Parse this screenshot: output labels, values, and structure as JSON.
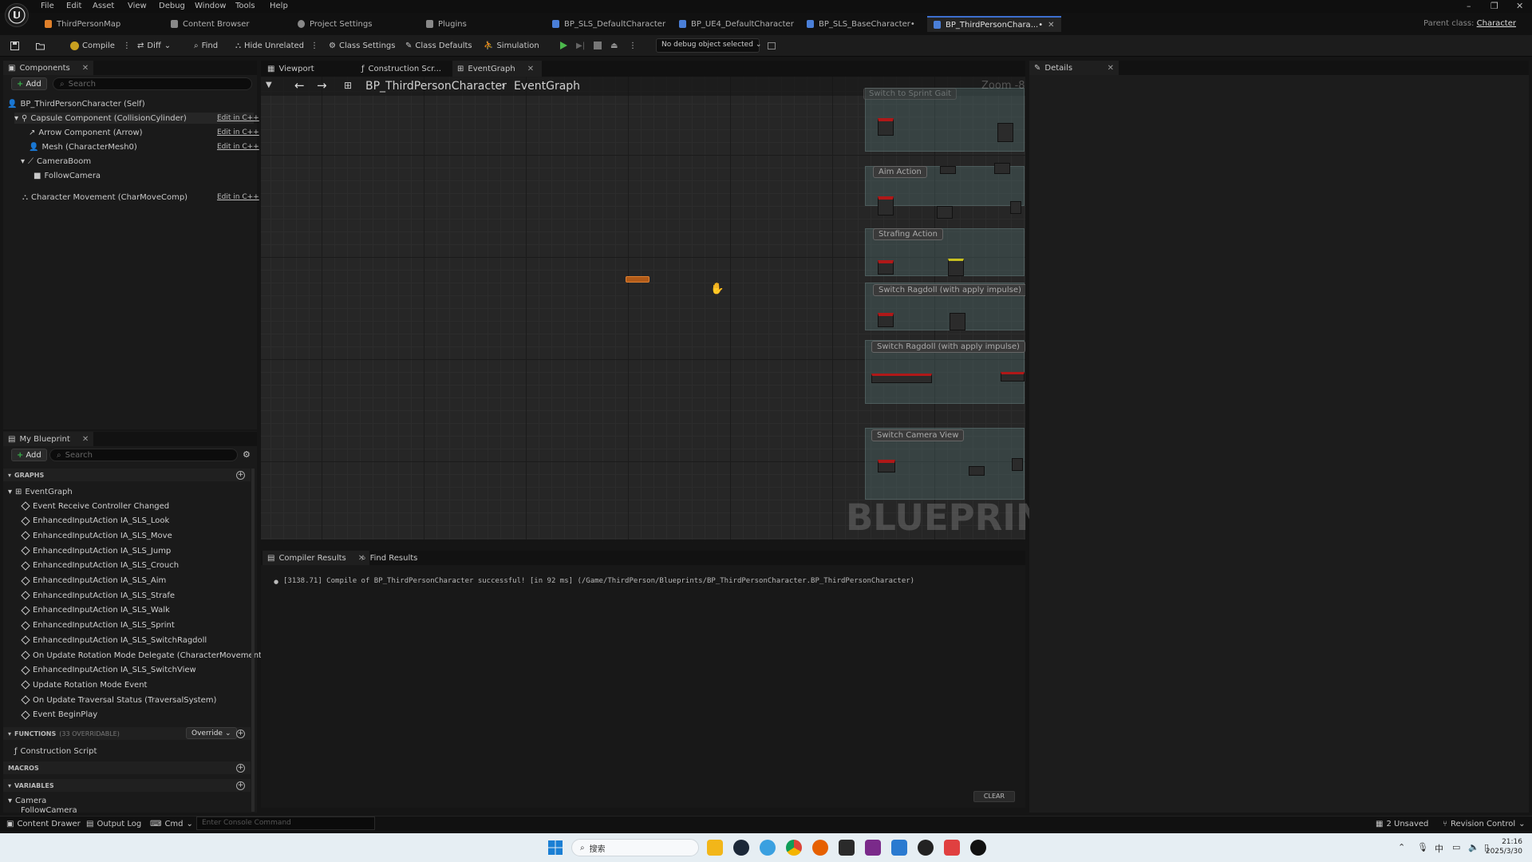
{
  "menu": [
    "File",
    "Edit",
    "Asset",
    "View",
    "Debug",
    "Window",
    "Tools",
    "Help"
  ],
  "doc_tabs": [
    {
      "label": "ThirdPersonMap",
      "color": "#e0802a"
    },
    {
      "label": "Content Browser",
      "color": "#999999"
    },
    {
      "label": "Project Settings",
      "color": "#999999"
    },
    {
      "label": "Plugins",
      "color": "#999999"
    },
    {
      "label": "BP_SLS_DefaultCharacter",
      "color": "#4a7fd8"
    },
    {
      "label": "BP_UE4_DefaultCharacter",
      "color": "#4a7fd8"
    },
    {
      "label": "BP_SLS_BaseCharacter•",
      "color": "#4a7fd8"
    },
    {
      "label": "BP_ThirdPersonChara...•",
      "color": "#4a7fd8"
    }
  ],
  "parent_class": {
    "label": "Parent class:",
    "value": "Character"
  },
  "toolbar": {
    "compile": "Compile",
    "diff": "Diff",
    "find": "Find",
    "hide_unrelated": "Hide Unrelated",
    "class_settings": "Class Settings",
    "class_defaults": "Class Defaults",
    "simulation": "Simulation",
    "debug_object": "No debug object selected"
  },
  "components_panel": {
    "tab": "Components",
    "add": "Add",
    "search_placeholder": "Search",
    "root": "BP_ThirdPersonCharacter (Self)",
    "items": [
      {
        "label": "Capsule Component (CollisionCylinder)",
        "edit": "Edit in C++"
      },
      {
        "label": "Arrow Component (Arrow)",
        "edit": "Edit in C++"
      },
      {
        "label": "Mesh (CharacterMesh0)",
        "edit": "Edit in C++"
      },
      {
        "label": "CameraBoom",
        "edit": ""
      },
      {
        "label": "FollowCamera",
        "edit": ""
      },
      {
        "label": "Character Movement (CharMoveComp)",
        "edit": "Edit in C++"
      }
    ]
  },
  "my_blueprint": {
    "tab": "My Blueprint",
    "add": "Add",
    "search_placeholder": "Search",
    "graphs_header": "GRAPHS",
    "event_graph": "EventGraph",
    "events": [
      "Event Receive Controller Changed",
      "EnhancedInputAction IA_SLS_Look",
      "EnhancedInputAction IA_SLS_Move",
      "EnhancedInputAction IA_SLS_Jump",
      "EnhancedInputAction IA_SLS_Crouch",
      "EnhancedInputAction IA_SLS_Aim",
      "EnhancedInputAction IA_SLS_Strafe",
      "EnhancedInputAction IA_SLS_Walk",
      "EnhancedInputAction IA_SLS_Sprint",
      "EnhancedInputAction IA_SLS_SwitchRagdoll",
      "On Update Rotation Mode Delegate (CharacterMovement)",
      "EnhancedInputAction IA_SLS_SwitchView",
      "Update Rotation Mode Event",
      "On Update Traversal Status (TraversalSystem)",
      "Event BeginPlay"
    ],
    "functions_header": "FUNCTIONS",
    "functions_sub": "(33 OVERRIDABLE)",
    "override": "Override",
    "construction_script": "Construction Script",
    "macros_header": "MACROS",
    "variables_header": "VARIABLES",
    "camera_category": "Camera",
    "camera_var": "FollowCamera"
  },
  "editor_tabs": [
    {
      "label": "Viewport"
    },
    {
      "label": "Construction Scr..."
    },
    {
      "label": "EventGraph"
    }
  ],
  "breadcrumb": {
    "blueprint": "BP_ThirdPersonCharacter",
    "graph": "EventGraph"
  },
  "graph": {
    "zoom": "Zoom -8",
    "watermark": "BLUEPRINT",
    "comments": [
      "Switch to Sprint Gait",
      "Aim Action",
      "Strafing Action",
      "Switch Ragdoll (with apply impulse)",
      "Switch Ragdoll (with apply impulse)",
      "Switch Camera View"
    ]
  },
  "details_panel": {
    "tab": "Details"
  },
  "results": {
    "tabs": [
      "Compiler Results",
      "Find Results"
    ],
    "log": "[3138.71] Compile of BP_ThirdPersonCharacter successful! [in 92 ms] (/Game/ThirdPerson/Blueprints/BP_ThirdPersonCharacter.BP_ThirdPersonCharacter)",
    "clear": "CLEAR"
  },
  "statusbar": {
    "content_drawer": "Content Drawer",
    "output_log": "Output Log",
    "cmd": "Cmd",
    "console_placeholder": "Enter Console Command",
    "unsaved": "2 Unsaved",
    "revision_control": "Revision Control"
  },
  "taskbar": {
    "search": "搜索",
    "time": "21:16",
    "date": "2025/3/30"
  }
}
